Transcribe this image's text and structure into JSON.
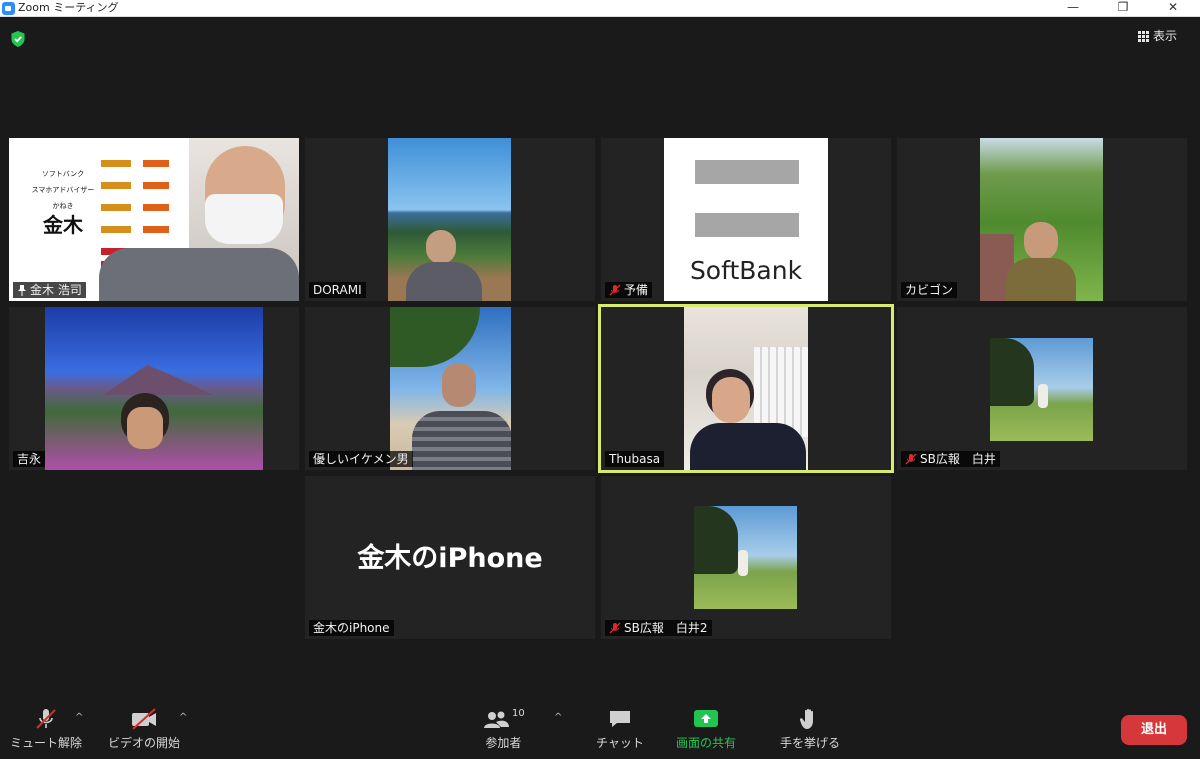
{
  "window": {
    "title": "Zoom ミーティング",
    "minimize": "—",
    "restore": "❐",
    "close": "✕"
  },
  "top": {
    "view_label": "表示"
  },
  "tiles": {
    "t1": {
      "name": "金木 浩司",
      "pinned": true,
      "slide": {
        "line1": "ソフトバンク",
        "line2": "スマホアドバイザー",
        "line3": "かねき",
        "line4": "金木"
      }
    },
    "t2": {
      "name": "DORAMI"
    },
    "t3": {
      "name": "予備",
      "muted": true,
      "logo_text": "SoftBank"
    },
    "t4": {
      "name": "カビゴン"
    },
    "t5": {
      "name": "吉永"
    },
    "t6": {
      "name": "優しいイケメン男"
    },
    "t7": {
      "name": "Thubasa",
      "active_speaker": true
    },
    "t8": {
      "name": "SB広報　白井",
      "muted": true
    },
    "t9": {
      "name": "金木のiPhone",
      "big_label": "金木のiPhone"
    },
    "t10": {
      "name": "SB広報　白井2",
      "muted": true
    }
  },
  "toolbar": {
    "mute_label": "ミュート解除",
    "video_label": "ビデオの開始",
    "participants_label": "参加者",
    "participants_count": "10",
    "chat_label": "チャット",
    "share_label": "画面の共有",
    "raise_hand_label": "手を挙げる",
    "leave_label": "退出"
  },
  "colors": {
    "accent_green": "#23c552",
    "active_outline": "#d7ec6e",
    "leave_red": "#d6373b",
    "mute_red": "#e02828"
  }
}
